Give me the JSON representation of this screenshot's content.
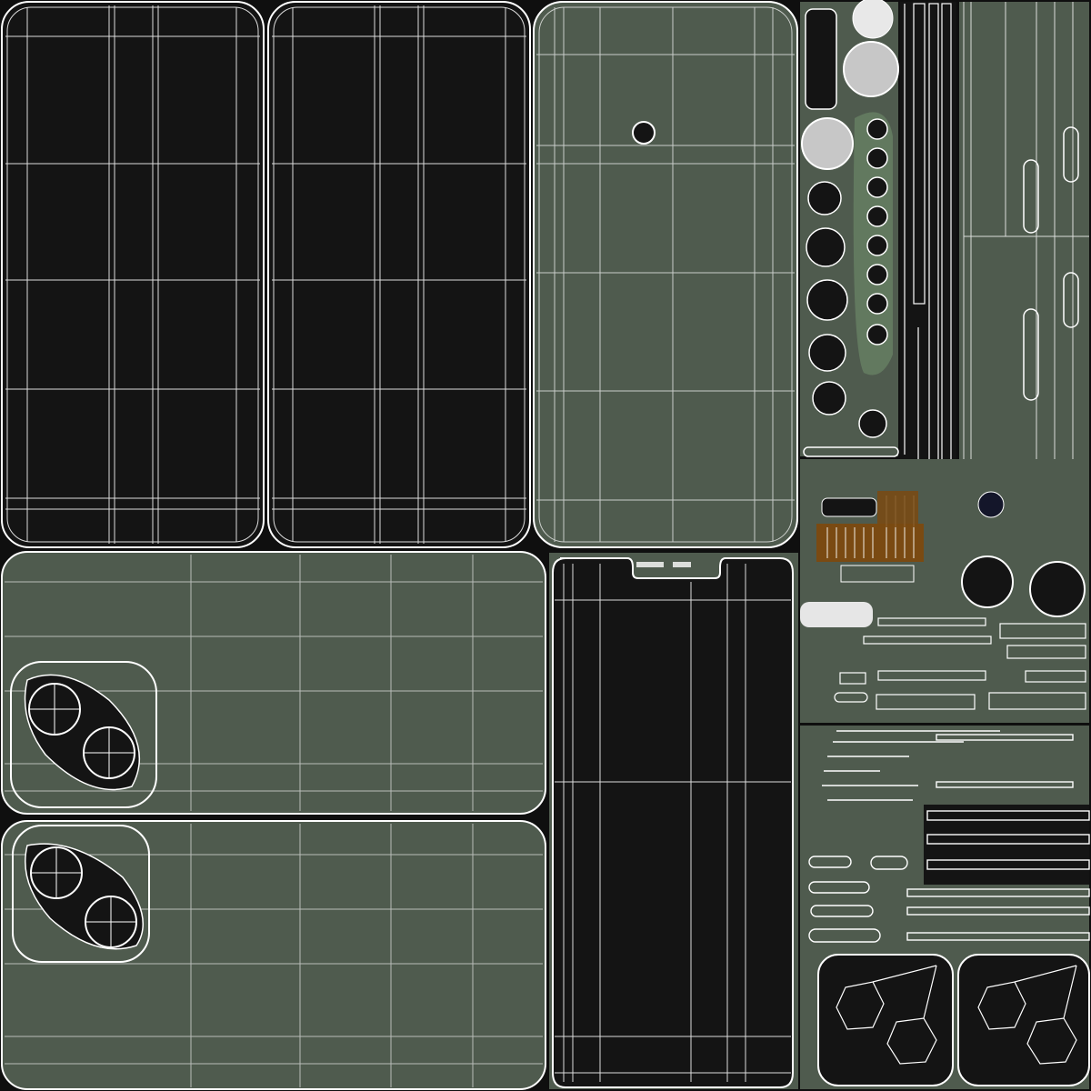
{
  "image": {
    "kind": "uv-texture-wireframe-layout",
    "colors": {
      "background": "#0f0f0f",
      "panel_green": "#4f5b4e",
      "panel_dark": "#141414",
      "panel_navy": "#14162a",
      "wire": "#ffffff",
      "wood": "#7a4a12",
      "highlight_gray": "#d8d8d8"
    },
    "shells": [
      {
        "name": "back-panel-left-dark",
        "fill": "panel_dark"
      },
      {
        "name": "back-panel-mid-dark",
        "fill": "panel_dark"
      },
      {
        "name": "screen-panel-green",
        "fill": "panel_green"
      },
      {
        "name": "camera-plate-top",
        "fill": "panel_green"
      },
      {
        "name": "camera-plate-bottom",
        "fill": "panel_green"
      },
      {
        "name": "front-screen-dark",
        "fill": "panel_dark"
      },
      {
        "name": "buttons-cluster",
        "fill": "panel_green"
      },
      {
        "name": "rails-strip",
        "fill": "panel_green"
      },
      {
        "name": "octagon-pads",
        "fill": "panel_dark"
      },
      {
        "name": "trim-strips",
        "fill": "panel_green"
      },
      {
        "name": "corner-caps",
        "fill": "panel_dark"
      }
    ]
  }
}
